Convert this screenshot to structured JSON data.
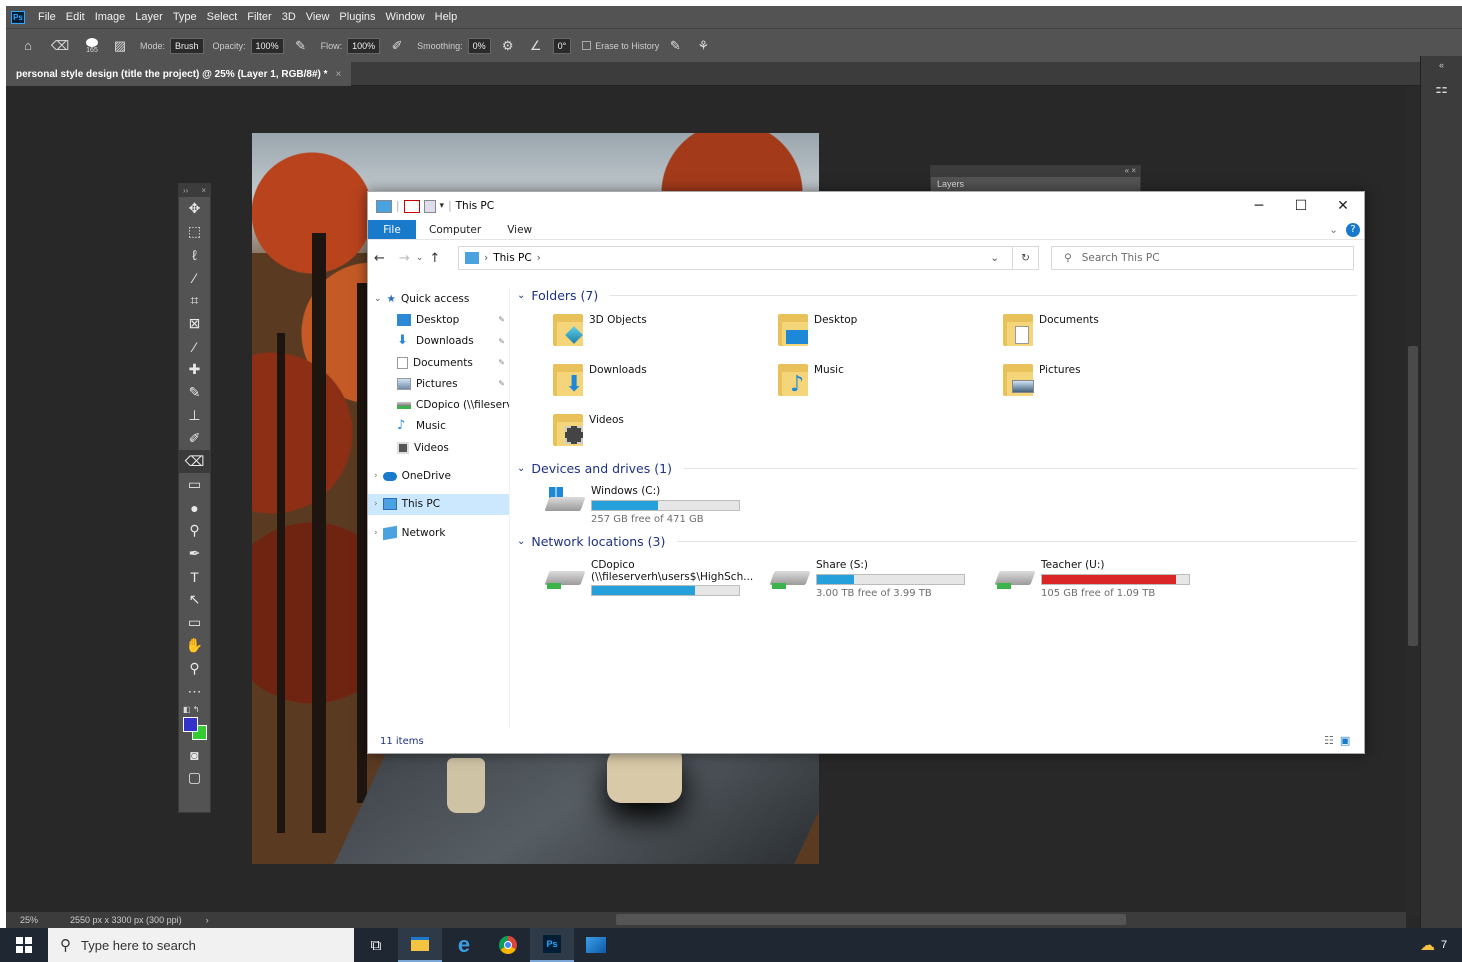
{
  "photoshop": {
    "logo": "Ps",
    "menu": [
      "File",
      "Edit",
      "Image",
      "Layer",
      "Type",
      "Select",
      "Filter",
      "3D",
      "View",
      "Plugins",
      "Window",
      "Help"
    ],
    "options": {
      "brush_size": "165",
      "mode_label": "Mode:",
      "mode_value": "Brush",
      "opacity_label": "Opacity:",
      "opacity_value": "100%",
      "flow_label": "Flow:",
      "flow_value": "100%",
      "smoothing_label": "Smoothing:",
      "smoothing_value": "0%",
      "angle_value": "0°",
      "erase_history_label": "Erase to History"
    },
    "doc_tab": "personal style design (title the project) @ 25% (Layer 1, RGB/8#) *",
    "doc_tab_close": "×",
    "layers_panel_tab": "Layers",
    "status": {
      "zoom": "25%",
      "dimensions": "2550 px x 3300 px (300 ppi)"
    },
    "tools": [
      "move-tool",
      "marquee-tool",
      "lasso-tool",
      "magic-wand-tool",
      "crop-tool",
      "frame-tool",
      "eyedropper-tool",
      "healing-brush-tool",
      "brush-tool",
      "clone-stamp-tool",
      "history-brush-tool",
      "eraser-tool",
      "gradient-tool",
      "blur-tool",
      "dodge-tool",
      "pen-tool",
      "type-tool",
      "path-selection-tool",
      "rectangle-tool",
      "hand-tool",
      "zoom-tool",
      "more-tools"
    ],
    "colors": {
      "foreground": "#3333cc",
      "background": "#33cc33"
    }
  },
  "explorer": {
    "title": "This PC",
    "ribbon": {
      "file": "File",
      "computer": "Computer",
      "view": "View"
    },
    "address": {
      "location": "This PC"
    },
    "search_placeholder": "Search This PC",
    "nav": {
      "quick_access": "Quick access",
      "items": [
        {
          "label": "Desktop",
          "pinned": true,
          "icon": "desktop-icon"
        },
        {
          "label": "Downloads",
          "pinned": true,
          "icon": "downloads-icon"
        },
        {
          "label": "Documents",
          "pinned": true,
          "icon": "documents-icon"
        },
        {
          "label": "Pictures",
          "pinned": true,
          "icon": "pictures-icon"
        },
        {
          "label": "CDopico (\\\\fileserve",
          "pinned": false,
          "icon": "network-drive-icon"
        },
        {
          "label": "Music",
          "pinned": false,
          "icon": "music-icon"
        },
        {
          "label": "Videos",
          "pinned": false,
          "icon": "videos-icon"
        }
      ],
      "onedrive": "OneDrive",
      "this_pc": "This PC",
      "network": "Network"
    },
    "folders_header": "Folders (7)",
    "folders": [
      "3D Objects",
      "Desktop",
      "Documents",
      "Downloads",
      "Music",
      "Pictures",
      "Videos"
    ],
    "devices_header": "Devices and drives (1)",
    "drive_c": {
      "name": "Windows (C:)",
      "free": "257 GB free of 471 GB",
      "used_fraction": 0.45
    },
    "network_header": "Network locations (3)",
    "network_drives": [
      {
        "name": "CDopico",
        "path": "(\\\\fileserverh\\users$\\HighSch...",
        "free": "",
        "used_fraction": 0.7,
        "color": "#26a0da"
      },
      {
        "name": "Share (S:)",
        "free": "3.00 TB free of 3.99 TB",
        "used_fraction": 0.25,
        "color": "#26a0da"
      },
      {
        "name": "Teacher (U:)",
        "free": "105 GB free of 1.09 TB",
        "used_fraction": 0.91,
        "color": "#da2626"
      }
    ],
    "item_count": "11 items"
  },
  "taskbar": {
    "search_placeholder": "Type here to search",
    "apps": [
      "task-view",
      "file-explorer",
      "edge",
      "chrome",
      "photoshop",
      "photos"
    ],
    "tray_text": "7"
  }
}
